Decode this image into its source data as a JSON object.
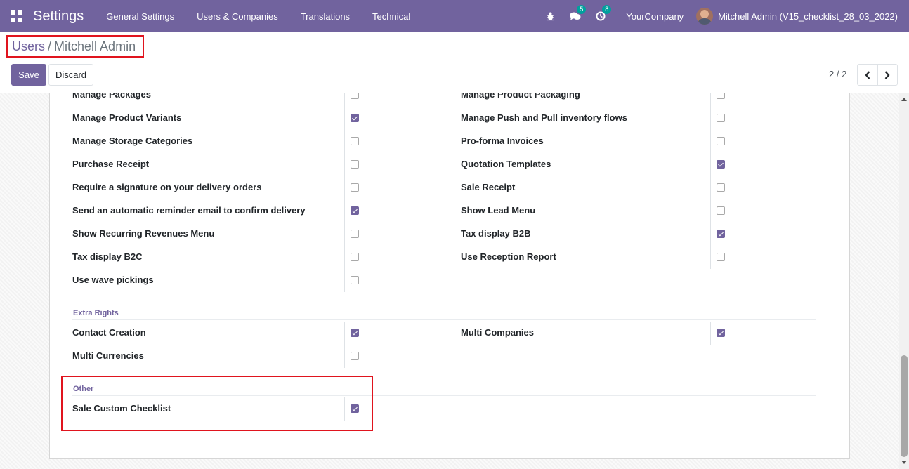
{
  "navbar": {
    "brand": "Settings",
    "menu": [
      "General Settings",
      "Users & Companies",
      "Translations",
      "Technical"
    ],
    "messages_count": "5",
    "activities_count": "8",
    "company": "YourCompany",
    "user": "Mitchell Admin (V15_checklist_28_03_2022)"
  },
  "breadcrumb": {
    "parent": "Users",
    "separator": "/",
    "current": "Mitchell Admin"
  },
  "buttons": {
    "save": "Save",
    "discard": "Discard"
  },
  "pager": {
    "value": "2 / 2"
  },
  "technical_rows": [
    {
      "left": "Manage Packages",
      "left_checked": false,
      "right": "Manage Product Packaging",
      "right_checked": false
    },
    {
      "left": "Manage Product Variants",
      "left_checked": true,
      "right": "Manage Push and Pull inventory flows",
      "right_checked": false
    },
    {
      "left": "Manage Storage Categories",
      "left_checked": false,
      "right": "Pro-forma Invoices",
      "right_checked": false
    },
    {
      "left": "Purchase Receipt",
      "left_checked": false,
      "right": "Quotation Templates",
      "right_checked": true
    },
    {
      "left": "Require a signature on your delivery orders",
      "left_checked": false,
      "right": "Sale Receipt",
      "right_checked": false
    },
    {
      "left": "Send an automatic reminder email to confirm delivery",
      "left_checked": true,
      "right": "Show Lead Menu",
      "right_checked": false
    },
    {
      "left": "Show Recurring Revenues Menu",
      "left_checked": false,
      "right": "Tax display B2B",
      "right_checked": true
    },
    {
      "left": "Tax display B2C",
      "left_checked": false,
      "right": "Use Reception Report",
      "right_checked": false
    },
    {
      "left": "Use wave pickings",
      "left_checked": false
    }
  ],
  "extra_rights": {
    "title": "Extra Rights",
    "rows": [
      {
        "left": "Contact Creation",
        "left_checked": true,
        "right": "Multi Companies",
        "right_checked": true
      },
      {
        "left": "Multi Currencies",
        "left_checked": false
      }
    ]
  },
  "other": {
    "title": "Other",
    "rows": [
      {
        "left": "Sale Custom Checklist",
        "left_checked": true
      }
    ]
  },
  "colors": {
    "brand": "#71639e",
    "highlight": "#e0141e",
    "badge": "#00a09d"
  }
}
